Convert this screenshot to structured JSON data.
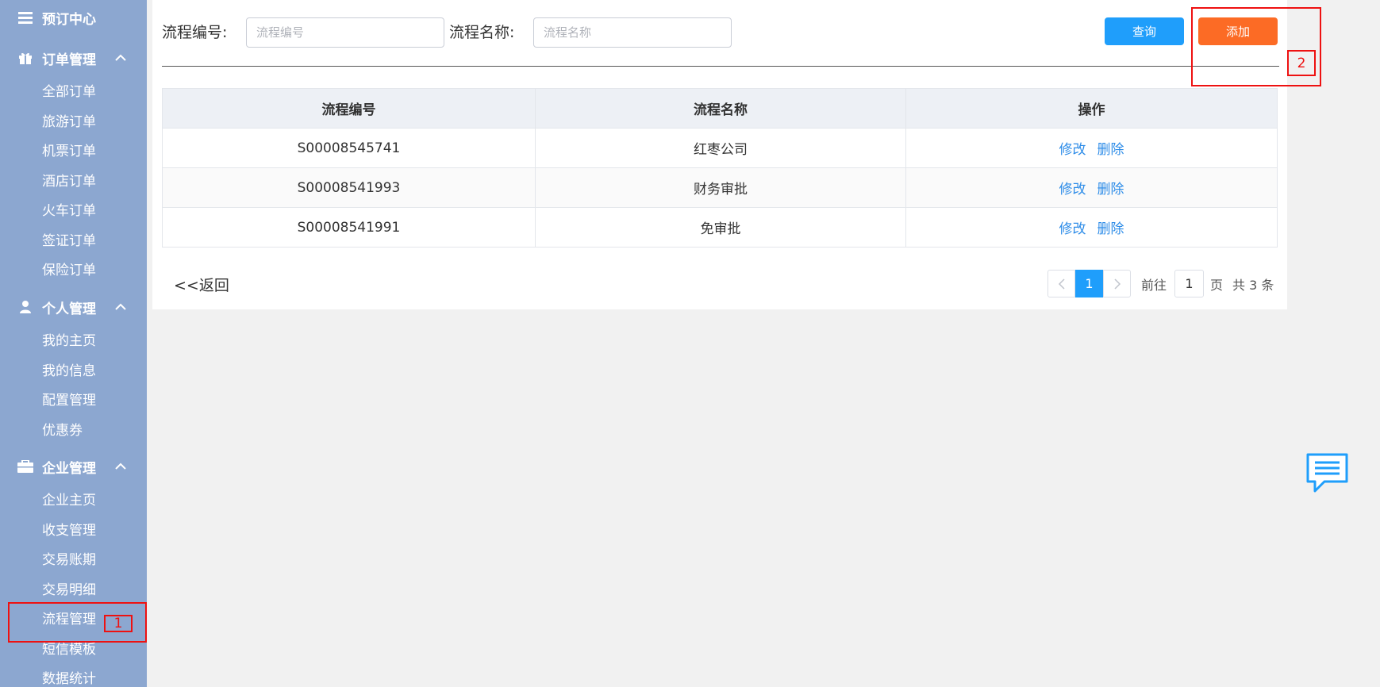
{
  "sidebar": {
    "top": {
      "label": "预订中心",
      "icon": "menu-icon"
    },
    "groups": [
      {
        "label": "订单管理",
        "icon": "gift-icon",
        "items": [
          "全部订单",
          "旅游订单",
          "机票订单",
          "酒店订单",
          "火车订单",
          "签证订单",
          "保险订单"
        ]
      },
      {
        "label": "个人管理",
        "icon": "user-icon",
        "items": [
          "我的主页",
          "我的信息",
          "配置管理",
          "优惠券"
        ]
      },
      {
        "label": "企业管理",
        "icon": "briefcase-icon",
        "items": [
          "企业主页",
          "收支管理",
          "交易账期",
          "交易明细",
          "流程管理",
          "短信模板",
          "数据统计"
        ]
      }
    ]
  },
  "filters": {
    "code_label": "流程编号:",
    "code_placeholder": "流程编号",
    "name_label": "流程名称:",
    "name_placeholder": "流程名称",
    "query_label": "查询",
    "add_label": "添加"
  },
  "table": {
    "headers": [
      "流程编号",
      "流程名称",
      "操作"
    ],
    "rows": [
      {
        "code": "S00008545741",
        "name": "红枣公司"
      },
      {
        "code": "S00008541993",
        "name": "财务审批"
      },
      {
        "code": "S00008541991",
        "name": "免审批"
      }
    ],
    "edit_label": "修改",
    "delete_label": "删除"
  },
  "back_label": "<<返回",
  "pager": {
    "current": "1",
    "goto_label": "前往",
    "goto_value": "1",
    "page_unit": "页",
    "total_text": "共 3 条"
  },
  "annotations": {
    "label_1": "1",
    "label_2": "2"
  },
  "colors": {
    "sidebar": "#8ca7d0",
    "primary": "#1f9efb",
    "add": "#fc6b25",
    "annotation": "#e11111"
  }
}
